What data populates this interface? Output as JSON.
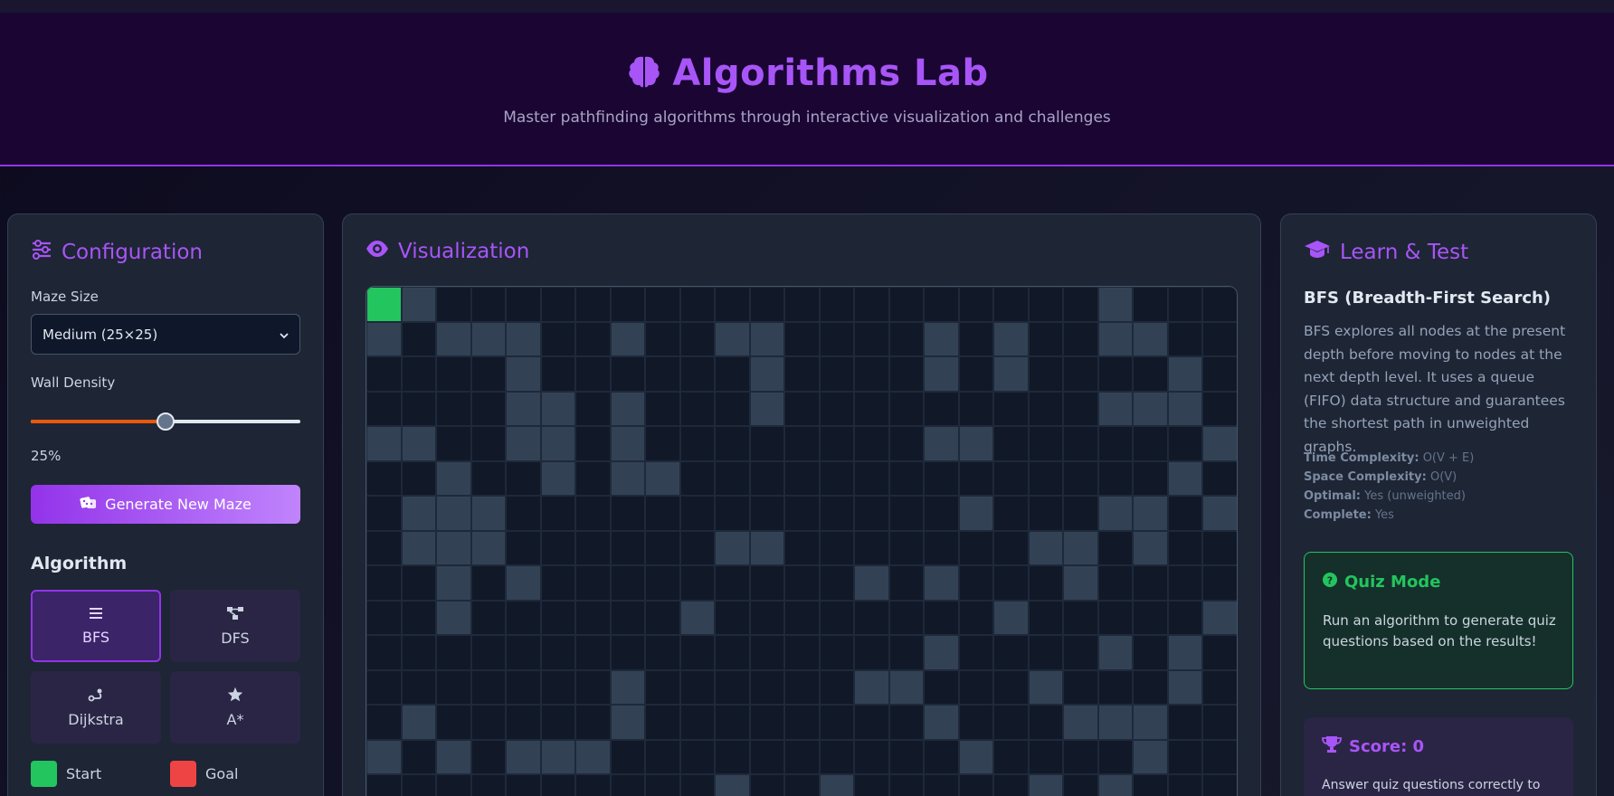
{
  "header": {
    "title": "Algorithms Lab",
    "subtitle": "Master pathfinding algorithms through interactive visualization and challenges",
    "brand_color": "#a855f7",
    "icon": "brain-icon"
  },
  "config": {
    "title": "Configuration",
    "icon": "sliders-icon",
    "maze_size_label": "Maze Size",
    "maze_size_value": "Medium (25×25)",
    "wall_density_label": "Wall Density",
    "wall_density_value": "25%",
    "wall_density_fraction": 0.5,
    "generate_label": "Generate New Maze",
    "algorithm_title": "Algorithm",
    "algorithms": [
      {
        "label": "BFS",
        "icon": "list-icon",
        "active": true
      },
      {
        "label": "DFS",
        "icon": "hierarchy-icon",
        "active": false
      },
      {
        "label": "Dijkstra",
        "icon": "route-icon",
        "active": false
      },
      {
        "label": "A*",
        "icon": "star-icon",
        "active": false
      }
    ],
    "legend": [
      {
        "label": "Start",
        "color": "#22c55e"
      },
      {
        "label": "Goal",
        "color": "#ef4444"
      }
    ]
  },
  "visualization": {
    "title": "Visualization",
    "icon": "eye-icon",
    "cols": 25,
    "walls": [
      "S1000000000000000000010001",
      "1011100100110000101001100",
      "0000100000010000101000010",
      "0000110100010000000001110",
      "1100110100000000110000001",
      "0010010110000000000000010",
      "0111000000000000010001101",
      "0111000000110000000110100",
      "0010100000000010100010000",
      "0010000001000000001000001",
      "0000000000000000100001010",
      "0000000100000011000100010",
      "0100000100000000100011100",
      "1010111000000000010000100",
      "0000000000100100000101000"
    ]
  },
  "learn": {
    "title": "Learn & Test",
    "icon": "graduation-cap-icon",
    "algo_name": "BFS (Breadth-First Search)",
    "algo_desc": "BFS explores all nodes at the present depth before moving to nodes at the next depth level. It uses a queue (FIFO) data structure and guarantees the shortest path in unweighted graphs.",
    "stats": [
      {
        "key": "Time Complexity:",
        "value": "O(V + E)"
      },
      {
        "key": "Space Complexity:",
        "value": "O(V)"
      },
      {
        "key": "Optimal:",
        "value": "Yes (unweighted)"
      },
      {
        "key": "Complete:",
        "value": "Yes"
      }
    ],
    "quiz_title": "Quiz Mode",
    "quiz_text": "Run an algorithm to generate quiz questions based on the results!",
    "score_title": "Score: 0",
    "score_text": "Answer quiz questions correctly to"
  }
}
